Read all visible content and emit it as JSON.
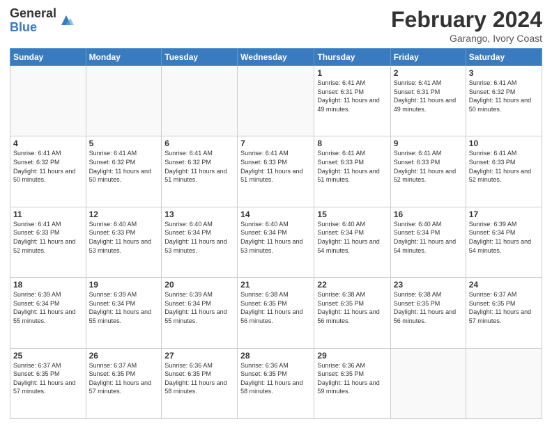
{
  "header": {
    "logo_general": "General",
    "logo_blue": "Blue",
    "month_year": "February 2024",
    "location": "Garango, Ivory Coast"
  },
  "days_of_week": [
    "Sunday",
    "Monday",
    "Tuesday",
    "Wednesday",
    "Thursday",
    "Friday",
    "Saturday"
  ],
  "weeks": [
    [
      {
        "day": "",
        "info": ""
      },
      {
        "day": "",
        "info": ""
      },
      {
        "day": "",
        "info": ""
      },
      {
        "day": "",
        "info": ""
      },
      {
        "day": "1",
        "info": "Sunrise: 6:41 AM\nSunset: 6:31 PM\nDaylight: 11 hours and 49 minutes."
      },
      {
        "day": "2",
        "info": "Sunrise: 6:41 AM\nSunset: 6:31 PM\nDaylight: 11 hours and 49 minutes."
      },
      {
        "day": "3",
        "info": "Sunrise: 6:41 AM\nSunset: 6:32 PM\nDaylight: 11 hours and 50 minutes."
      }
    ],
    [
      {
        "day": "4",
        "info": "Sunrise: 6:41 AM\nSunset: 6:32 PM\nDaylight: 11 hours and 50 minutes."
      },
      {
        "day": "5",
        "info": "Sunrise: 6:41 AM\nSunset: 6:32 PM\nDaylight: 11 hours and 50 minutes."
      },
      {
        "day": "6",
        "info": "Sunrise: 6:41 AM\nSunset: 6:32 PM\nDaylight: 11 hours and 51 minutes."
      },
      {
        "day": "7",
        "info": "Sunrise: 6:41 AM\nSunset: 6:33 PM\nDaylight: 11 hours and 51 minutes."
      },
      {
        "day": "8",
        "info": "Sunrise: 6:41 AM\nSunset: 6:33 PM\nDaylight: 11 hours and 51 minutes."
      },
      {
        "day": "9",
        "info": "Sunrise: 6:41 AM\nSunset: 6:33 PM\nDaylight: 11 hours and 52 minutes."
      },
      {
        "day": "10",
        "info": "Sunrise: 6:41 AM\nSunset: 6:33 PM\nDaylight: 11 hours and 52 minutes."
      }
    ],
    [
      {
        "day": "11",
        "info": "Sunrise: 6:41 AM\nSunset: 6:33 PM\nDaylight: 11 hours and 52 minutes."
      },
      {
        "day": "12",
        "info": "Sunrise: 6:40 AM\nSunset: 6:33 PM\nDaylight: 11 hours and 53 minutes."
      },
      {
        "day": "13",
        "info": "Sunrise: 6:40 AM\nSunset: 6:34 PM\nDaylight: 11 hours and 53 minutes."
      },
      {
        "day": "14",
        "info": "Sunrise: 6:40 AM\nSunset: 6:34 PM\nDaylight: 11 hours and 53 minutes."
      },
      {
        "day": "15",
        "info": "Sunrise: 6:40 AM\nSunset: 6:34 PM\nDaylight: 11 hours and 54 minutes."
      },
      {
        "day": "16",
        "info": "Sunrise: 6:40 AM\nSunset: 6:34 PM\nDaylight: 11 hours and 54 minutes."
      },
      {
        "day": "17",
        "info": "Sunrise: 6:39 AM\nSunset: 6:34 PM\nDaylight: 11 hours and 54 minutes."
      }
    ],
    [
      {
        "day": "18",
        "info": "Sunrise: 6:39 AM\nSunset: 6:34 PM\nDaylight: 11 hours and 55 minutes."
      },
      {
        "day": "19",
        "info": "Sunrise: 6:39 AM\nSunset: 6:34 PM\nDaylight: 11 hours and 55 minutes."
      },
      {
        "day": "20",
        "info": "Sunrise: 6:39 AM\nSunset: 6:34 PM\nDaylight: 11 hours and 55 minutes."
      },
      {
        "day": "21",
        "info": "Sunrise: 6:38 AM\nSunset: 6:35 PM\nDaylight: 11 hours and 56 minutes."
      },
      {
        "day": "22",
        "info": "Sunrise: 6:38 AM\nSunset: 6:35 PM\nDaylight: 11 hours and 56 minutes."
      },
      {
        "day": "23",
        "info": "Sunrise: 6:38 AM\nSunset: 6:35 PM\nDaylight: 11 hours and 56 minutes."
      },
      {
        "day": "24",
        "info": "Sunrise: 6:37 AM\nSunset: 6:35 PM\nDaylight: 11 hours and 57 minutes."
      }
    ],
    [
      {
        "day": "25",
        "info": "Sunrise: 6:37 AM\nSunset: 6:35 PM\nDaylight: 11 hours and 57 minutes."
      },
      {
        "day": "26",
        "info": "Sunrise: 6:37 AM\nSunset: 6:35 PM\nDaylight: 11 hours and 57 minutes."
      },
      {
        "day": "27",
        "info": "Sunrise: 6:36 AM\nSunset: 6:35 PM\nDaylight: 11 hours and 58 minutes."
      },
      {
        "day": "28",
        "info": "Sunrise: 6:36 AM\nSunset: 6:35 PM\nDaylight: 11 hours and 58 minutes."
      },
      {
        "day": "29",
        "info": "Sunrise: 6:36 AM\nSunset: 6:35 PM\nDaylight: 11 hours and 59 minutes."
      },
      {
        "day": "",
        "info": ""
      },
      {
        "day": "",
        "info": ""
      }
    ]
  ]
}
